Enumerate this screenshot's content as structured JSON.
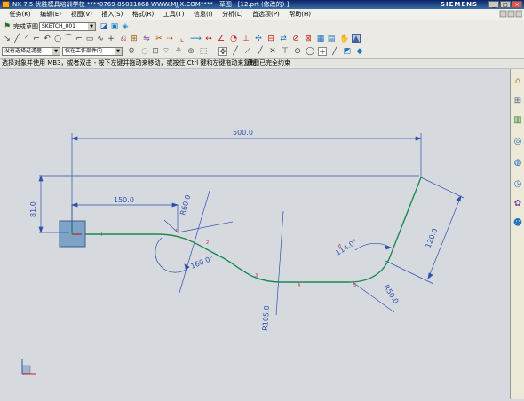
{
  "title": {
    "text": "NX 7.5 优胜模具培训学校 ****0769-85031868 WWW.MJJX.COM**** - 草图 - [12.prt (修改的) ]",
    "brand": "SIEMENS"
  },
  "menu": [
    "任务(K)",
    "编辑(E)",
    "视图(V)",
    "插入(S)",
    "格式(R)",
    "工具(T)",
    "信息(I)",
    "分析(L)",
    "首选项(P)",
    "帮助(H)"
  ],
  "toolbar": {
    "finish_sketch": "完成草图",
    "sketch_name": "SKETCH_001",
    "selection_filter": "没有选择过滤器",
    "assembly_scope": "仅在工作部件内"
  },
  "cue_line": "选择对象并使用 MB3，或者双击 - 按下左键并拖动来移动，或按住 Ctrl 键和左键拖动来复制",
  "status_line": "草图已完全约束",
  "sketch": {
    "dimensions": [
      {
        "id": "width",
        "text": "500.0"
      },
      {
        "id": "height",
        "text": "81.0"
      },
      {
        "id": "offset",
        "text": "150.0"
      },
      {
        "id": "radius1",
        "text": "R60.0"
      },
      {
        "id": "angle1",
        "text": "160.0°"
      },
      {
        "id": "radius2",
        "text": "R105.0"
      },
      {
        "id": "angle2",
        "text": "114.0°"
      },
      {
        "id": "radius3",
        "text": "R50.0"
      },
      {
        "id": "length",
        "text": "120.0"
      }
    ]
  }
}
